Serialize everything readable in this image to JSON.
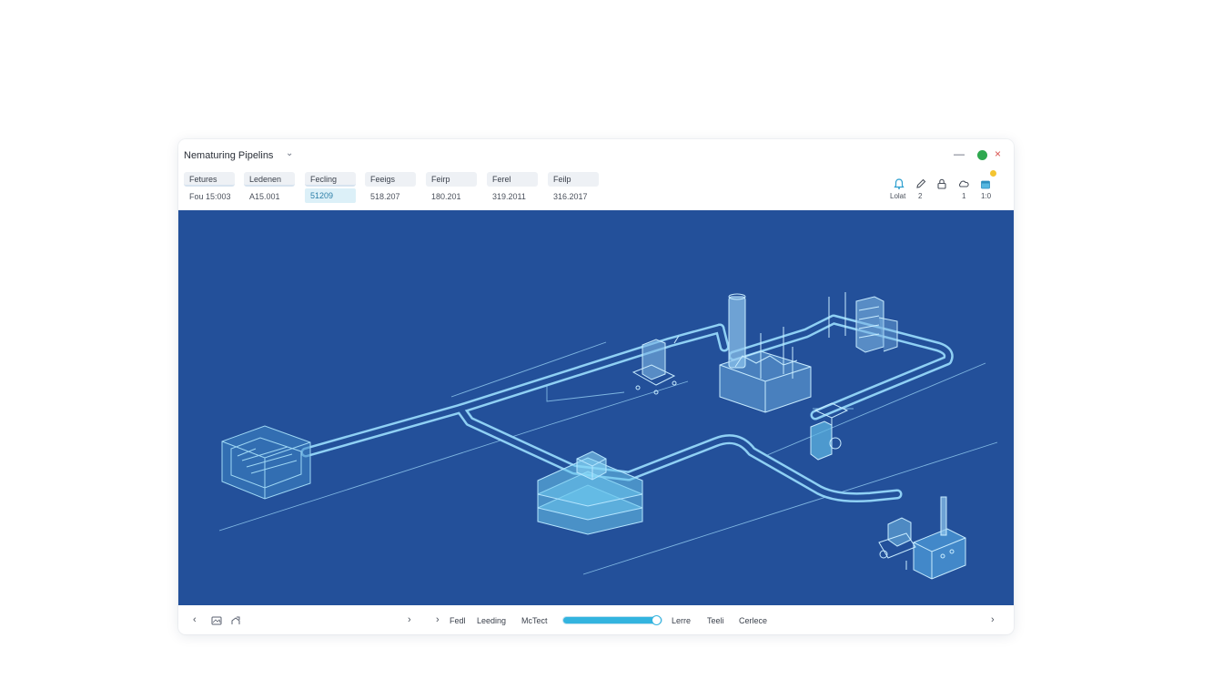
{
  "window": {
    "title": "Nematuring Pipelins",
    "controls": {
      "minimize": "—",
      "close": "×"
    }
  },
  "tabs": [
    {
      "label": "Fetures",
      "value": "Fou 15:003"
    },
    {
      "label": "Ledenen",
      "value": "A15.001"
    },
    {
      "label": "Fecling",
      "value": "51209"
    },
    {
      "label": "Feeigs",
      "value": "518.207"
    },
    {
      "label": "Feirp",
      "value": "180.201"
    },
    {
      "label": "Ferel",
      "value": "319.2011"
    },
    {
      "label": "Feilp",
      "value": "316.2017"
    }
  ],
  "toolbar": {
    "icons": [
      {
        "name": "bell-icon",
        "count": "Lolat"
      },
      {
        "name": "pen-icon",
        "count": "2"
      },
      {
        "name": "lock-icon",
        "count": ""
      },
      {
        "name": "cloud-icon",
        "count": "1"
      },
      {
        "name": "package-icon",
        "count": "1:0"
      }
    ]
  },
  "bottom_bar": {
    "prev": "‹",
    "next": "›",
    "mid_prev": "›",
    "mid_next": "›",
    "labels": [
      "Fedl",
      "Leeding",
      "McTect"
    ],
    "progress": 0.95,
    "right_labels": [
      "Lerre",
      "Teeli",
      "Cerlece"
    ]
  },
  "colors": {
    "canvas": "#23509a",
    "accent": "#33b4df",
    "pipe": "#7fc9f0"
  }
}
